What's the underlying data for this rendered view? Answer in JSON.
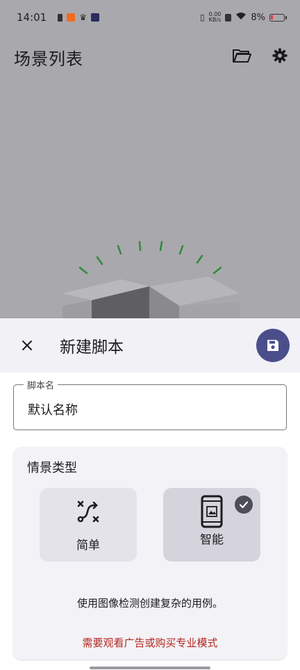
{
  "status_bar": {
    "time": "14:01",
    "net_speed_value": "0.00",
    "net_speed_unit": "KB/s",
    "battery": "8%"
  },
  "app_bar": {
    "title": "场景列表",
    "folder_icon": "folder-open-icon",
    "settings_icon": "gear-icon"
  },
  "sheet": {
    "title": "新建脚本",
    "close_icon": "close-icon",
    "save_icon": "save-icon",
    "name_field": {
      "label": "脚本名",
      "value": "默认名称"
    },
    "scene_type": {
      "title": "情景类型",
      "options": [
        {
          "label": "简单",
          "icon": "route-icon",
          "selected": false
        },
        {
          "label": "智能",
          "icon": "phone-image-icon",
          "selected": true
        }
      ],
      "description": "使用图像检测创建复杂的用例。",
      "notice": "需要观看广告或购买专业模式"
    }
  },
  "colors": {
    "accent": "#4a4f8c",
    "scrim": "#a9a8ad",
    "warning_text": "#b3261e",
    "sparkle": "#2e8b3a"
  }
}
